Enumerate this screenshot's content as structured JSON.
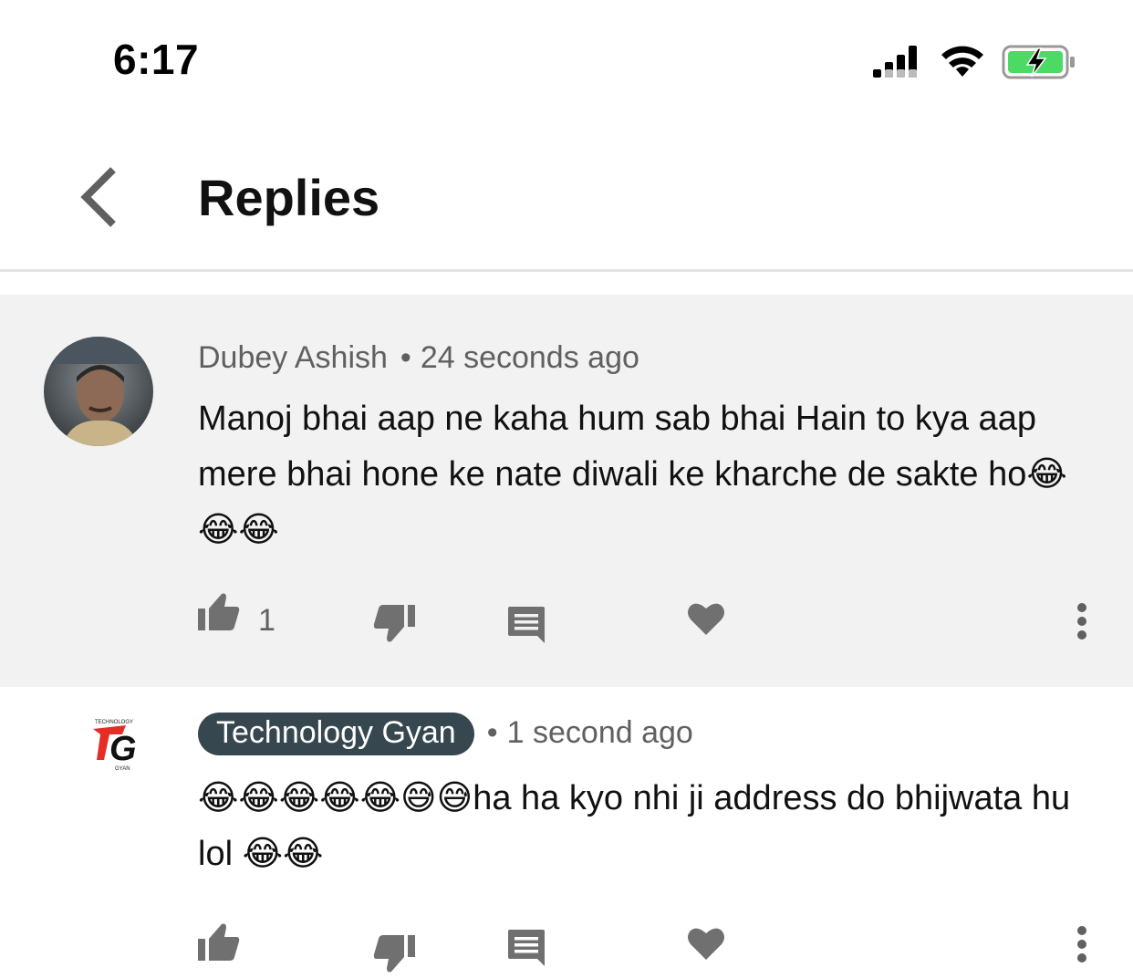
{
  "status_bar": {
    "time": "6:17",
    "icons": [
      "cellular-signal-icon",
      "wifi-icon",
      "battery-charging-icon"
    ],
    "battery_color": "#4cd964"
  },
  "header": {
    "title": "Replies",
    "back_icon": "chevron-left-icon"
  },
  "comments": [
    {
      "author": "Dubey Ashish",
      "separator": "•",
      "timestamp": "24 seconds ago",
      "text": "Manoj bhai aap ne kaha hum sab bhai Hain to kya aap mere bhai hone ke nate diwali ke kharche de sakte ho😂😂😂",
      "like_count": "1",
      "highlighted": true,
      "background": "#f2f2f2"
    },
    {
      "author": "Technology Gyan",
      "separator": "•",
      "timestamp": "1 second ago",
      "text": "😂😂😂😂😂😅😅ha ha kyo nhi ji address do bhijwata hu lol 😂😂",
      "like_count": "",
      "is_channel_owner": true,
      "badge_color": "#37474f"
    }
  ],
  "logo_lettering": [
    "TECHNOLOGY",
    "G",
    "GYAN"
  ],
  "action_icons": [
    "thumbs-up-icon",
    "thumbs-down-icon",
    "reply-icon",
    "heart-icon",
    "more-vert-icon"
  ]
}
